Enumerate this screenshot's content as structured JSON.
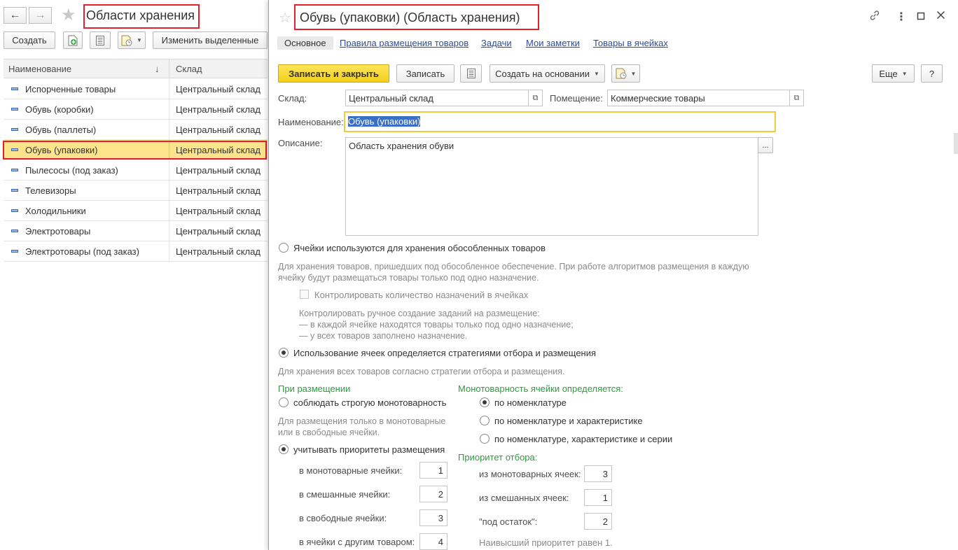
{
  "list_window": {
    "title": "Области хранения",
    "toolbar": {
      "create_label": "Создать",
      "edit_selected_label": "Изменить выделенные"
    },
    "columns": {
      "name": "Наименование",
      "sort_mark": "↓",
      "warehouse": "Склад"
    },
    "rows": [
      {
        "name": "Испорченные товары",
        "warehouse": "Центральный склад"
      },
      {
        "name": "Обувь (коробки)",
        "warehouse": "Центральный склад"
      },
      {
        "name": "Обувь (паллеты)",
        "warehouse": "Центральный склад"
      },
      {
        "name": "Обувь (упаковки)",
        "warehouse": "Центральный склад"
      },
      {
        "name": "Пылесосы (под заказ)",
        "warehouse": "Центральный склад"
      },
      {
        "name": "Телевизоры",
        "warehouse": "Центральный склад"
      },
      {
        "name": "Холодильники",
        "warehouse": "Центральный склад"
      },
      {
        "name": "Электротовары",
        "warehouse": "Центральный склад"
      },
      {
        "name": "Электротовары (под заказ)",
        "warehouse": "Центральный склад"
      }
    ],
    "selected_row": "Обувь (упаковки)"
  },
  "form": {
    "title": "Обувь (упаковки) (Область хранения)",
    "tabs": [
      {
        "label": "Основное",
        "active": true
      },
      {
        "label": "Правила размещения товаров"
      },
      {
        "label": "Задачи"
      },
      {
        "label": "Мои заметки"
      },
      {
        "label": "Товары в ячейках"
      }
    ],
    "toolbar": {
      "save_close": "Записать и закрыть",
      "save": "Записать",
      "create_based": "Создать на основании",
      "more": "Еще",
      "help": "?"
    },
    "fields": {
      "warehouse_label": "Склад:",
      "warehouse_value": "Центральный склад",
      "room_label": "Помещение:",
      "room_value": "Коммерческие товары",
      "name_label": "Наименование:",
      "name_value": "Обувь (упаковки)",
      "description_label": "Описание:",
      "description_value": "Область хранения обуви",
      "description_more": "..."
    },
    "isolated": {
      "radio_label": "Ячейки используются для хранения обособленных товаров",
      "hint_line1": "Для хранения товаров, пришедших под обособленное обеспечение. При работе алгоритмов размещения в каждую",
      "hint_line2": "ячейку будут размещаться товары только под одно назначение.",
      "checkbox_label": "Контролировать количество назначений в ячейках",
      "control_hint_1": "Контролировать ручное создание заданий на размещение:",
      "control_hint_2": "— в каждой ячейке находятся товары только под одно назначение;",
      "control_hint_3": "— у всех товаров заполнено назначение."
    },
    "strategy": {
      "radio_label": "Использование ячеек определяется стратегиями отбора и размещения",
      "hint": "Для хранения всех товаров согласно стратегии отбора и размещения."
    },
    "placement": {
      "title": "При размещении",
      "strict_label": "соблюдать строгую монотоварность",
      "strict_hint_1": "Для размещения только в монотоварные",
      "strict_hint_2": "или в свободные ячейки.",
      "priorities_label": "учитывать приоритеты размещения",
      "rows": [
        {
          "label": "в монотоварные ячейки:",
          "value": "1"
        },
        {
          "label": "в смешанные ячейки:",
          "value": "2"
        },
        {
          "label": "в свободные ячейки:",
          "value": "3"
        },
        {
          "label": "в ячейки с другим товаром:",
          "value": "4"
        }
      ]
    },
    "monotype": {
      "title": "Монотоварность ячейки определяется:",
      "options": [
        {
          "label": "по номенклатуре",
          "selected": true
        },
        {
          "label": "по номенклатуре и характеристике"
        },
        {
          "label": "по номенклатуре, характеристике и серии"
        }
      ]
    },
    "pick_priority": {
      "title": "Приоритет отбора:",
      "rows": [
        {
          "label": "из монотоварных ячеек:",
          "value": "3"
        },
        {
          "label": "из смешанных ячеек:",
          "value": "1"
        },
        {
          "label": "\"под остаток\":",
          "value": "2"
        }
      ],
      "note": "Наивысший приоритет равен 1."
    }
  },
  "colors": {
    "highlight_box": "#e3202b",
    "selected_row": "#fbe48b",
    "primary_button": "#f4cf1b",
    "link": "#2b4d9b",
    "section_title": "#2e9b3f"
  }
}
